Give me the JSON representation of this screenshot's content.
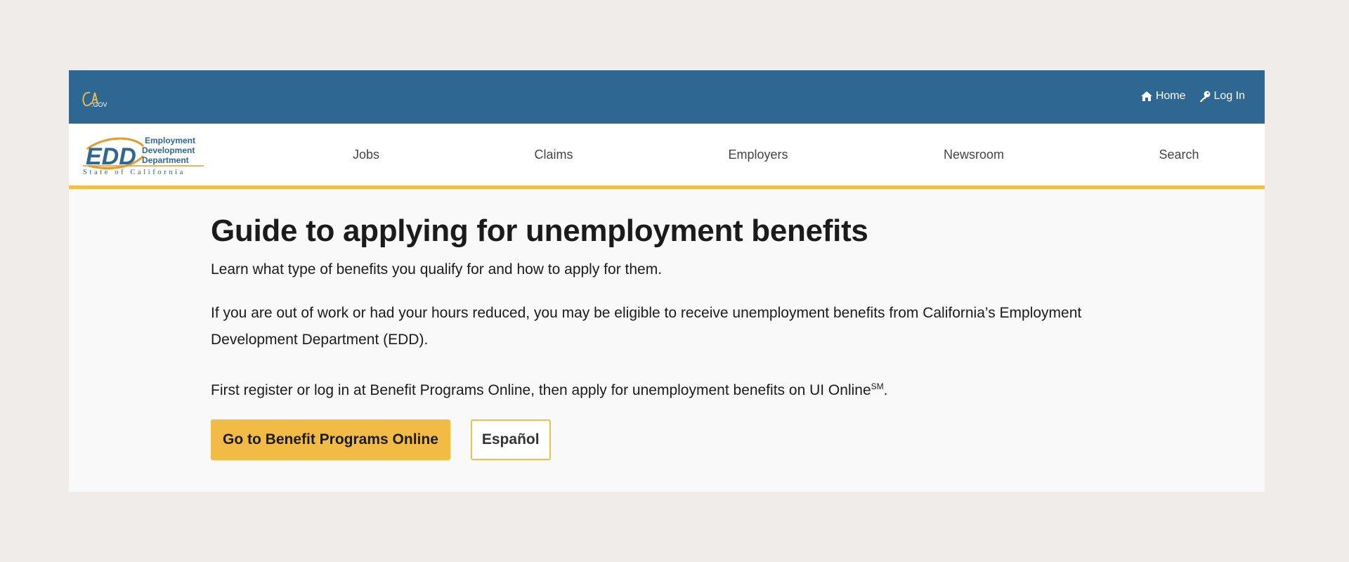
{
  "utility_bar": {
    "color": "#2f6793",
    "logo_text": "CA.GOV",
    "links": [
      {
        "label": "Home",
        "icon": "home-icon"
      },
      {
        "label": "Log In",
        "icon": "key-icon"
      }
    ]
  },
  "header": {
    "logo": {
      "abbr": "EDD",
      "line1": "Employment",
      "line2": "Development",
      "line3": "Department",
      "tagline": "State of California"
    },
    "nav": [
      {
        "label": "Jobs"
      },
      {
        "label": "Claims"
      },
      {
        "label": "Employers"
      },
      {
        "label": "Newsroom"
      },
      {
        "label": "Search"
      }
    ],
    "accent_color": "#efc048"
  },
  "main": {
    "title": "Guide to applying for unemployment benefits",
    "lead": "Learn what type of benefits you qualify for and how to apply for them.",
    "paragraph1": "If you are out of work or had your hours reduced, you may be eligible to receive unemployment benefits from California’s Employment Development Department (EDD).",
    "paragraph2_text": "First register or log in at Benefit Programs Online, then apply for unemployment benefits on UI Online",
    "paragraph2_mark": "SM",
    "paragraph2_end": ".",
    "buttons": {
      "primary_label": "Go to Benefit Programs Online",
      "secondary_label": "Español"
    }
  }
}
